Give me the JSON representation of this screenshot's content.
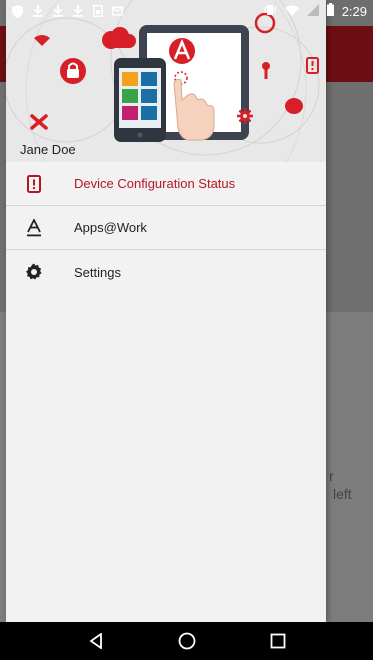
{
  "status_bar": {
    "time": "2:29",
    "left_icons": [
      "shield-icon",
      "download-icon",
      "download-icon",
      "download-icon",
      "sim-card-icon",
      "mail-icon"
    ],
    "right_icons": [
      "vibrate-icon",
      "wifi-icon",
      "signal-icon",
      "battery-icon"
    ]
  },
  "drawer": {
    "user_name": "Jane Doe",
    "menu": [
      {
        "label": "Device Configuration Status",
        "icon": "device-status-icon",
        "active": true
      },
      {
        "label": "Apps@Work",
        "icon": "apps-at-work-icon",
        "active": false
      },
      {
        "label": "Settings",
        "icon": "gear-icon",
        "active": false
      }
    ]
  },
  "background": {
    "partial_text_1": "r",
    "partial_text_2": "left"
  },
  "colors": {
    "accent": "#b51821",
    "toolbar": "#6b0f14"
  },
  "nav_bar": {
    "buttons": [
      "back-icon",
      "home-icon",
      "recents-icon"
    ]
  }
}
